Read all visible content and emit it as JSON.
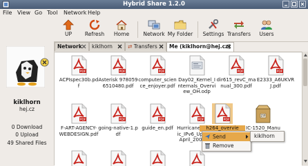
{
  "window": {
    "title": "Hybrid Share 1.2.0"
  },
  "menu": {
    "items": [
      "File",
      "View",
      "Go",
      "Tool",
      "Network",
      "Help"
    ]
  },
  "toolbar": {
    "items": [
      {
        "label": "UP",
        "icon": "up-arrow-icon"
      },
      {
        "label": "Refresh",
        "icon": "refresh-icon"
      },
      {
        "label": "Home",
        "icon": "home-icon"
      },
      {
        "label": "Network",
        "icon": "network-icon"
      },
      {
        "label": "My Folder",
        "icon": "my-folder-icon"
      },
      {
        "label": "Settings",
        "icon": "settings-icon"
      },
      {
        "label": "Transfers",
        "icon": "transfers-icon"
      },
      {
        "label": "Users",
        "icon": "users-icon"
      }
    ]
  },
  "user": {
    "name": "kiklhorn",
    "host": "hej.cz",
    "downloads": "0 Download",
    "uploads": "0 Upload",
    "shared": "49 Shared Files"
  },
  "tabs": [
    {
      "label": "Network"
    },
    {
      "label": "kiklhorn"
    },
    {
      "label": "Transfers"
    },
    {
      "label": "Me (kiklhorn@hej.cz)"
    }
  ],
  "files": [
    {
      "name": "ACPIspec30b.pdf",
      "icon": "pdf-file-icon"
    },
    {
      "name": "Asterisk 9780596510480.pdf",
      "icon": "pdf-file-icon"
    },
    {
      "name": "computer_science_enjoyer.pdf",
      "icon": "pdf-file-icon"
    },
    {
      "name": "Day02_Kernel_Internals_Overview_OH.odp",
      "icon": "odp-file-icon"
    },
    {
      "name": "dir615_revC_manual_300.pdf",
      "icon": "pdf-file-icon"
    },
    {
      "name": "E2333_A6UKVRJ.pdf",
      "icon": "pdf-file-icon"
    },
    {
      "name": "F-ART-AGENCY-WEBDESIGN.pdf",
      "icon": "pdf-file-icon"
    },
    {
      "name": "going-native-1.pdf",
      "icon": "pdf-file-icon"
    },
    {
      "name": "guide_en.pdf",
      "icon": "pdf-file-icon"
    },
    {
      "name": "Hurricane_Electric_IPv6_Update_April_2008.pdf",
      "icon": "pdf-file-icon"
    },
    {
      "name": "h264_overvie",
      "icon": "pdf-file-icon"
    },
    {
      "name": "IC-1520_Manu",
      "icon": "zip-archive-icon"
    }
  ],
  "context_menu": {
    "items": [
      {
        "label": "Send",
        "icon": "send-icon"
      },
      {
        "label": "Remove",
        "icon": "remove-icon"
      }
    ],
    "submenu": {
      "label": "kiklhorn"
    }
  },
  "colors": {
    "titlebar": "#4a5c76",
    "selection": "#e6a84a",
    "pdf_red": "#c8261f"
  }
}
